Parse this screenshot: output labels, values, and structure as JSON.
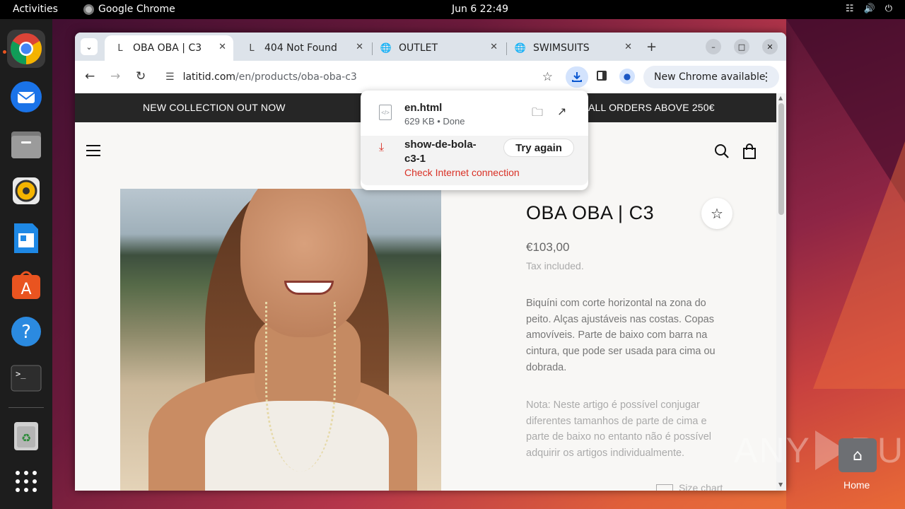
{
  "topbar": {
    "activities": "Activities",
    "app_name": "Google Chrome",
    "clock": "Jun 6  22:49"
  },
  "dock": {
    "items": [
      "chrome-icon",
      "thunderbird-icon",
      "files-icon",
      "rhythmbox-icon",
      "writer-icon",
      "app-center-icon",
      "help-icon",
      "terminal-icon",
      "trash-icon",
      "app-grid-icon"
    ]
  },
  "browser": {
    "tabs": [
      {
        "label": "OBA OBA | C3",
        "favicon": "L",
        "active": true
      },
      {
        "label": "404 Not Found",
        "favicon": "L",
        "active": false
      },
      {
        "label": "OUTLET",
        "favicon": "globe",
        "active": false
      },
      {
        "label": "SWIMSUITS",
        "favicon": "globe",
        "active": false
      }
    ],
    "url_host": "latitid.com",
    "url_path": "/en/products/oba-oba-c3",
    "update_label": "New Chrome available"
  },
  "downloads": {
    "items": [
      {
        "name": "en.html",
        "meta": "629 KB • Done"
      },
      {
        "name_line1": "show-de-bola-",
        "name_line2": "c3-1",
        "error": "Check Internet connection",
        "action": "Try again"
      }
    ]
  },
  "page": {
    "banner_left": "NEW COLLECTION OUT NOW",
    "banner_right": "ALL ORDERS ABOVE 250€",
    "product": {
      "title": "OBA OBA | C3",
      "price": "€103,00",
      "tax": "Tax included.",
      "description": "Biquíni com corte horizontal na zona do peito. Alças ajustáveis nas costas. Copas amovíveis. Parte de baixo com barra na cintura, que pode ser usada para cima ou dobrada.",
      "note": "Nota: Neste artigo é possível conjugar diferentes tamanhos de parte de cima e parte de baixo no entanto não é possível adquirir os artigos individualmente.",
      "size_chart": "Size chart"
    }
  },
  "desktop": {
    "watermark_left": "ANY",
    "watermark_right": "RUN",
    "home_label": "Home"
  }
}
